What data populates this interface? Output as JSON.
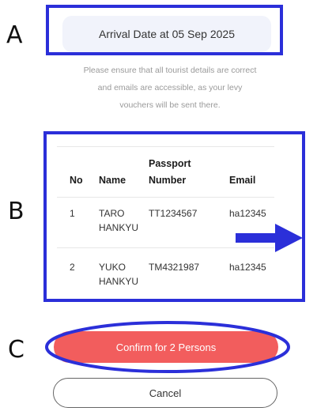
{
  "callouts": {
    "a": "A",
    "b": "B",
    "c": "C"
  },
  "arrival": {
    "text": "Arrival Date at 05 Sep 2025"
  },
  "info": {
    "lines": [
      "Please ensure that all tourist details are correct",
      "and emails are accessible, as your levy",
      "vouchers will be sent there."
    ]
  },
  "table": {
    "headers": {
      "no": "No",
      "name": "Name",
      "passport_line1": "Passport",
      "passport_line2": "Number",
      "email": "Email"
    },
    "rows": [
      {
        "no": "1",
        "name_line1": "TARO",
        "name_line2": "HANKYU",
        "passport": "TT1234567",
        "email": "ha12345"
      },
      {
        "no": "2",
        "name_line1": "YUKO",
        "name_line2": "HANKYU",
        "passport": "TM4321987",
        "email": "ha12345"
      }
    ]
  },
  "buttons": {
    "confirm": "Confirm for 2 Persons",
    "cancel": "Cancel"
  },
  "colors": {
    "annotation": "#2b2fd9",
    "confirm_bg": "#f25d5d",
    "pill_bg": "#f1f3fb"
  },
  "icons": {
    "scroll_hint": "right-arrow-icon"
  }
}
